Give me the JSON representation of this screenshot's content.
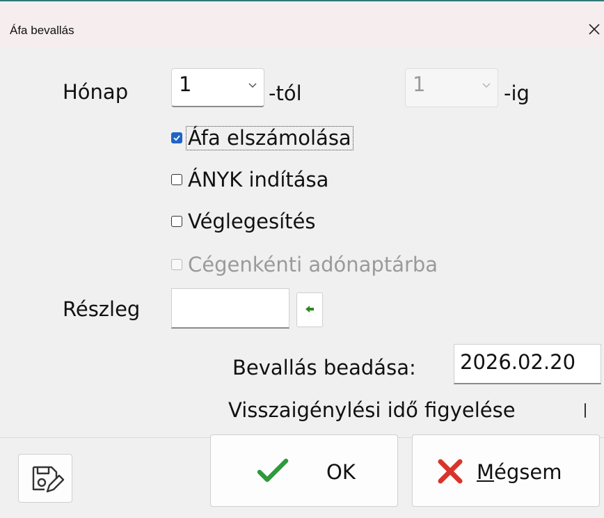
{
  "window": {
    "title": "Áfa bevallás"
  },
  "period": {
    "month_label": "Hónap",
    "from_value": "1",
    "from_suffix": "-tól",
    "to_value": "1",
    "to_suffix": "-ig"
  },
  "options": [
    {
      "label": "Áfa elszámolása",
      "checked": true,
      "enabled": true
    },
    {
      "label": "ÁNYK indítása",
      "checked": false,
      "enabled": true
    },
    {
      "label": "Véglegesítés",
      "checked": false,
      "enabled": true
    },
    {
      "label": "Cégenkénti adónaptárba",
      "checked": false,
      "enabled": false
    }
  ],
  "department": {
    "label": "Részleg",
    "value": ""
  },
  "submission": {
    "label": "Bevallás beadása:",
    "date": "2026.02.20"
  },
  "refund_watch": {
    "label": "Visszaigénylési idő figyelése",
    "checked": false
  },
  "buttons": {
    "ok_label": "OK",
    "cancel_mnemonic": "M",
    "cancel_rest": "égsem"
  },
  "colors": {
    "accent_blue": "#1f63c6",
    "ok_green": "#2e9a3c",
    "cancel_red": "#d9342b",
    "picker_green": "#2d8a1e"
  },
  "icons": {
    "close": "close-icon",
    "save_edit": "save-edit-icon",
    "ok": "checkmark-icon",
    "cancel": "x-icon",
    "picker": "arrow-left-icon"
  }
}
